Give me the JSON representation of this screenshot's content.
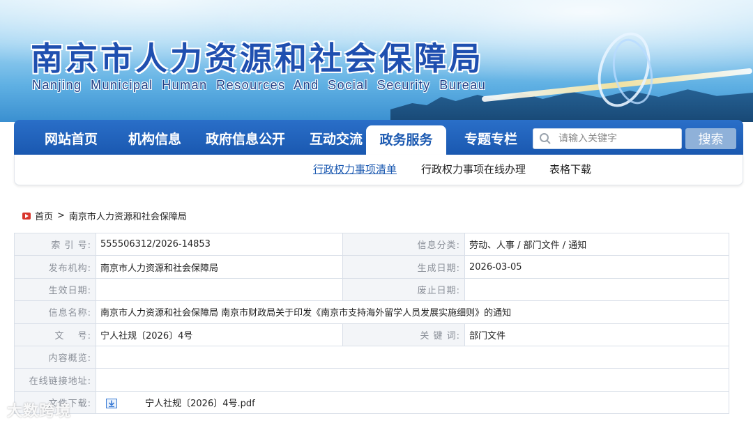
{
  "banner": {
    "title_cn": "南京市人力资源和社会保障局",
    "title_en": "Nanjing Municipal Human Resources And Social Security Bureau"
  },
  "nav": {
    "items": [
      {
        "label": "网站首页"
      },
      {
        "label": "机构信息"
      },
      {
        "label": "政府信息公开"
      },
      {
        "label": "互动交流"
      },
      {
        "label": "政务服务",
        "active": true
      },
      {
        "label": "专题专栏"
      }
    ],
    "search_placeholder": "请输入关键字",
    "search_button": "搜索"
  },
  "subnav": {
    "items": [
      {
        "label": "行政权力事项清单",
        "active": true
      },
      {
        "label": "行政权力事项在线办理"
      },
      {
        "label": "表格下载"
      }
    ]
  },
  "breadcrumb": {
    "home": "首页",
    "separator": ">",
    "current": "南京市人力资源和社会保障局"
  },
  "info": {
    "index_label": "索 引 号:",
    "index_value": "555506312/2026-14853",
    "category_label": "信息分类:",
    "category_value": "劳动、人事 / 部门文件 / 通知",
    "publisher_label": "发布机构:",
    "publisher_value": "南京市人力资源和社会保障局",
    "created_label": "生成日期:",
    "created_value": "2026-03-05",
    "effective_label": "生效日期:",
    "effective_value": "",
    "expiry_label": "废止日期:",
    "expiry_value": "",
    "name_label": "信息名称:",
    "name_value": "南京市人力资源和社会保障局 南京市财政局关于印发《南京市支持海外留学人员发展实施细则》的通知",
    "docno_label": "文　 号:",
    "docno_value": "宁人社规〔2026〕4号",
    "keywords_label": "关 键 词:",
    "keywords_value": "部门文件",
    "summary_label": "内容概览:",
    "summary_value": "",
    "link_label": "在线链接地址:",
    "link_value": "",
    "download_label": "文件下载:",
    "download_file": "宁人社规〔2026〕4号.pdf"
  },
  "watermark": "大数跨境"
}
